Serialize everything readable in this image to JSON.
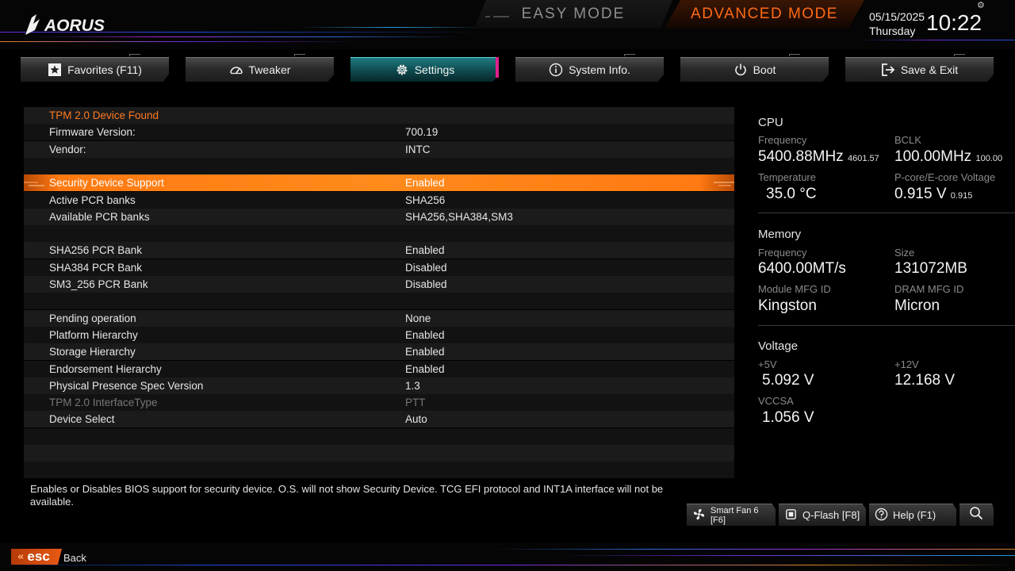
{
  "header": {
    "logo_text": "AORUS",
    "easy_mode_label": "EASY MODE",
    "advanced_mode_label": "ADVANCED MODE",
    "date": "05/15/2025",
    "day": "Thursday",
    "time": "10:22"
  },
  "tabs": [
    {
      "label": "Favorites (F11)",
      "icon": "star-icon",
      "active": false
    },
    {
      "label": "Tweaker",
      "icon": "speedometer-icon",
      "active": false
    },
    {
      "label": "Settings",
      "icon": "gear-icon",
      "active": true
    },
    {
      "label": "System Info.",
      "icon": "info-icon",
      "active": false
    },
    {
      "label": "Boot",
      "icon": "power-icon",
      "active": false
    },
    {
      "label": "Save & Exit",
      "icon": "exit-icon",
      "active": false
    }
  ],
  "settings": {
    "rows": [
      {
        "label": "TPM 2.0 Device Found",
        "value": "",
        "type": "header"
      },
      {
        "label": "Firmware Version:",
        "value": "700.19"
      },
      {
        "label": "Vendor:",
        "value": "INTC"
      },
      {
        "label": "",
        "value": ""
      },
      {
        "label": "Security Device Support",
        "value": "Enabled",
        "type": "selected"
      },
      {
        "label": "Active PCR banks",
        "value": "SHA256"
      },
      {
        "label": "Available PCR banks",
        "value": "SHA256,SHA384,SM3"
      },
      {
        "label": "",
        "value": ""
      },
      {
        "label": "SHA256 PCR Bank",
        "value": "Enabled"
      },
      {
        "label": "SHA384 PCR Bank",
        "value": "Disabled"
      },
      {
        "label": "SM3_256 PCR Bank",
        "value": "Disabled"
      },
      {
        "label": "",
        "value": ""
      },
      {
        "label": "Pending operation",
        "value": "None"
      },
      {
        "label": "Platform Hierarchy",
        "value": "Enabled"
      },
      {
        "label": "Storage Hierarchy",
        "value": "Enabled"
      },
      {
        "label": "Endorsement Hierarchy",
        "value": "Enabled"
      },
      {
        "label": "Physical Presence Spec Version",
        "value": "1.3"
      },
      {
        "label": "TPM 2.0 InterfaceType",
        "value": "PTT",
        "type": "dim"
      },
      {
        "label": "Device Select",
        "value": "Auto"
      },
      {
        "label": "",
        "value": ""
      },
      {
        "label": "",
        "value": ""
      },
      {
        "label": "",
        "value": ""
      }
    ]
  },
  "info": {
    "cpu": {
      "title": "CPU",
      "frequency_label": "Frequency",
      "frequency_value": "5400.88MHz",
      "frequency_sub": "4601.57",
      "bclk_label": "BCLK",
      "bclk_value": "100.00MHz",
      "bclk_sub": "100.00",
      "temperature_label": "Temperature",
      "temperature_value": "35.0 °C",
      "voltage_label": "P-core/E-core Voltage",
      "voltage_value": "0.915 V",
      "voltage_sub": "0.915"
    },
    "memory": {
      "title": "Memory",
      "frequency_label": "Frequency",
      "frequency_value": "6400.00MT/s",
      "size_label": "Size",
      "size_value": "131072MB",
      "module_label": "Module MFG ID",
      "module_value": "Kingston",
      "dram_label": "DRAM MFG ID",
      "dram_value": "Micron"
    },
    "voltage": {
      "title": "Voltage",
      "p5_label": "+5V",
      "p5_value": "5.092 V",
      "p12_label": "+12V",
      "p12_value": "12.168 V",
      "vccsa_label": "VCCSA",
      "vccsa_value": "1.056 V"
    }
  },
  "help_text": "Enables or Disables BIOS support for security device. O.S. will not show Security Device. TCG EFI protocol and INT1A interface will not be available.",
  "bottom_buttons": {
    "smart_fan": "Smart Fan 6 [F6]",
    "qflash": "Q-Flash [F8]",
    "help": "Help (F1)"
  },
  "footer": {
    "esc_label": "esc",
    "back_label": "Back"
  },
  "colors": {
    "accent_orange": "#ff7a12",
    "active_tab_teal": "#1f7a80",
    "active_tab_pink": "#e0208c"
  }
}
